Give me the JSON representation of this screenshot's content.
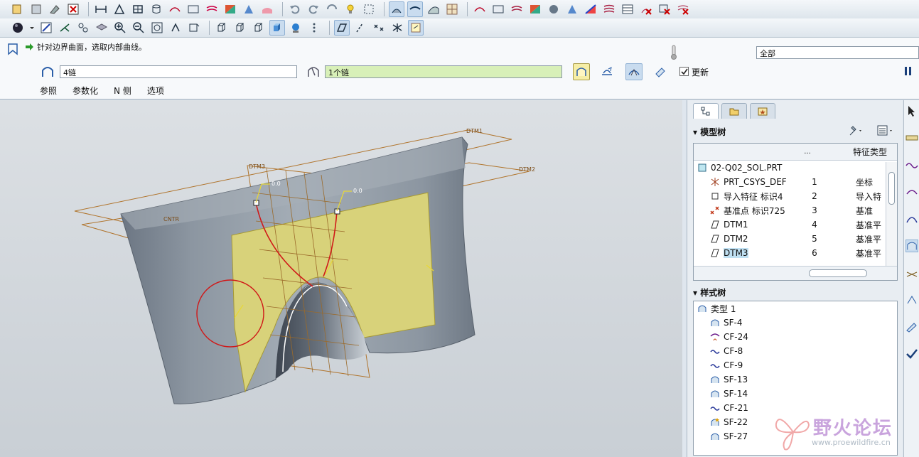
{
  "dashboard": {
    "prompt": "针对边界曲面，选取内部曲线。",
    "filter_value": "全部",
    "chain1_value": "4链",
    "chain2_value": "1个链",
    "update_label": "更新",
    "tabs": [
      {
        "label": "参照"
      },
      {
        "label": "参数化"
      },
      {
        "label": "N 侧"
      },
      {
        "label": "选项"
      }
    ]
  },
  "viewport": {
    "labels": [
      "DTM1",
      "DTM2",
      "DTM3",
      "CNTR",
      "0.0",
      "0.0"
    ]
  },
  "model_tree": {
    "title": "模型树",
    "col_dots": "...",
    "col_type": "特征类型",
    "root": "02-Q02_SOL.PRT",
    "rows": [
      {
        "name": "PRT_CSYS_DEF",
        "num": "1",
        "type": "坐标",
        "icon": "csys-icon"
      },
      {
        "name": "导入特征 标识4",
        "num": "2",
        "type": "导入特",
        "icon": "import-feature-icon"
      },
      {
        "name": "基准点 标识725",
        "num": "3",
        "type": "基准",
        "icon": "datum-point-icon"
      },
      {
        "name": "DTM1",
        "num": "4",
        "type": "基准平",
        "icon": "datum-plane-icon"
      },
      {
        "name": "DTM2",
        "num": "5",
        "type": "基准平",
        "icon": "datum-plane-icon"
      },
      {
        "name": "DTM3",
        "num": "6",
        "type": "基准平",
        "icon": "datum-plane-icon"
      }
    ]
  },
  "style_tree": {
    "title": "样式树",
    "root": "类型 1",
    "items": [
      {
        "name": "SF-4",
        "icon": "surface-icon"
      },
      {
        "name": "CF-24",
        "icon": "curve-icon"
      },
      {
        "name": "CF-8",
        "icon": "curve-icon"
      },
      {
        "name": "CF-9",
        "icon": "curve-icon"
      },
      {
        "name": "SF-13",
        "icon": "surface-icon"
      },
      {
        "name": "SF-14",
        "icon": "surface-icon"
      },
      {
        "name": "CF-21",
        "icon": "curve-icon"
      },
      {
        "name": "SF-22",
        "icon": "surface-icon"
      },
      {
        "name": "SF-27",
        "icon": "surface-icon"
      }
    ]
  },
  "watermark": {
    "title": "野火论坛",
    "url": "www.proewildfire.cn"
  },
  "colors": {
    "accent": "#1a4f9c",
    "surface": "#8f9aa6",
    "selected_surface": "#d8d27a",
    "curve": "#d01818",
    "datum": "#b8742a"
  }
}
